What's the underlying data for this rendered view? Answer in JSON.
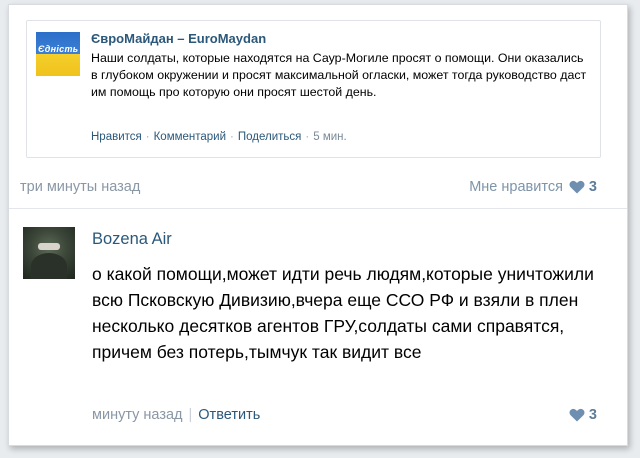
{
  "post": {
    "title": "ЄвроМайдан – EuroMaydan",
    "avatar_text": "Єдність",
    "text": "Наши солдаты, которые находятся на Саур-Могиле просят о помощи. Они оказались в глубоком окружении и просят максимальной огласки, может тогда руководство даст им помощь про которую они просят шестой день.",
    "actions": {
      "like": "Нравится",
      "comment": "Комментарий",
      "share": "Поделиться",
      "time": "5 мин."
    }
  },
  "share_row": {
    "time": "три минуты назад",
    "like_label": "Мне нравится",
    "like_count": "3"
  },
  "comment": {
    "author": "Bozena Air",
    "text": "о какой помощи,может идти речь людям,которые уничтожили всю Псковскую Дивизию,вчера еще ССО РФ и взяли в плен несколько десятков агентов ГРУ,солдаты сами справятся, причем без потерь,тымчук так видит все",
    "time": "минуту назад",
    "reply": "Ответить",
    "like_count": "3"
  },
  "colors": {
    "link": "#2b587a",
    "muted": "#8a97a5",
    "heart": "#6f8fb0"
  },
  "icons": {
    "heart": "heart-icon"
  }
}
